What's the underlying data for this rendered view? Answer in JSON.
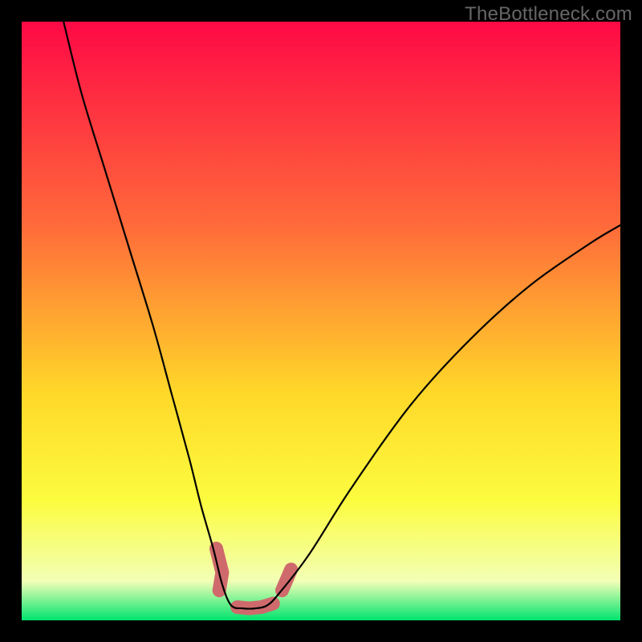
{
  "brand": "TheBottleneck.com",
  "colors": {
    "black": "#000000",
    "curve": "#000000",
    "blob": "#cf6a6c",
    "grad_top": "#fe0945",
    "grad_mid1": "#ff6a3a",
    "grad_mid2": "#ffd829",
    "grad_mid3": "#fcfc3f",
    "grad_mid4": "#f2ffb6",
    "grad_bot": "#00e46e"
  },
  "chart_data": {
    "type": "line",
    "title": "",
    "xlabel": "",
    "ylabel": "",
    "xlim": [
      0,
      100
    ],
    "ylim": [
      0,
      100
    ],
    "series": [
      {
        "name": "bottleneck-curve",
        "x": [
          7,
          10,
          14,
          18,
          22,
          25,
          28,
          30,
          32,
          33.5,
          35,
          37,
          39,
          41,
          43,
          48,
          55,
          65,
          75,
          85,
          95,
          100
        ],
        "values": [
          100,
          88,
          75,
          62,
          49,
          38,
          27,
          19,
          12,
          6,
          2.5,
          2,
          2,
          2.5,
          4.5,
          11,
          22,
          36,
          47,
          56,
          63,
          66
        ]
      }
    ],
    "blob_clusters": [
      {
        "name": "left-cluster",
        "cx": 33.0,
        "cy": 8.0,
        "points": [
          [
            32.5,
            12
          ],
          [
            33.5,
            8
          ],
          [
            33,
            5
          ]
        ]
      },
      {
        "name": "bottom-cluster",
        "cx": 38.5,
        "cy": 2.5,
        "points": [
          [
            36,
            2.2
          ],
          [
            38,
            2.0
          ],
          [
            40,
            2.2
          ],
          [
            42,
            2.8
          ]
        ]
      },
      {
        "name": "right-cluster",
        "cx": 44.5,
        "cy": 7.0,
        "points": [
          [
            43.5,
            5
          ],
          [
            45,
            8.5
          ]
        ]
      }
    ],
    "gradient_stops": [
      {
        "offset": 0.0,
        "key": "grad_top"
      },
      {
        "offset": 0.34,
        "key": "grad_mid1"
      },
      {
        "offset": 0.62,
        "key": "grad_mid2"
      },
      {
        "offset": 0.8,
        "key": "grad_mid3"
      },
      {
        "offset": 0.935,
        "key": "grad_mid4"
      },
      {
        "offset": 1.0,
        "key": "grad_bot"
      }
    ]
  }
}
